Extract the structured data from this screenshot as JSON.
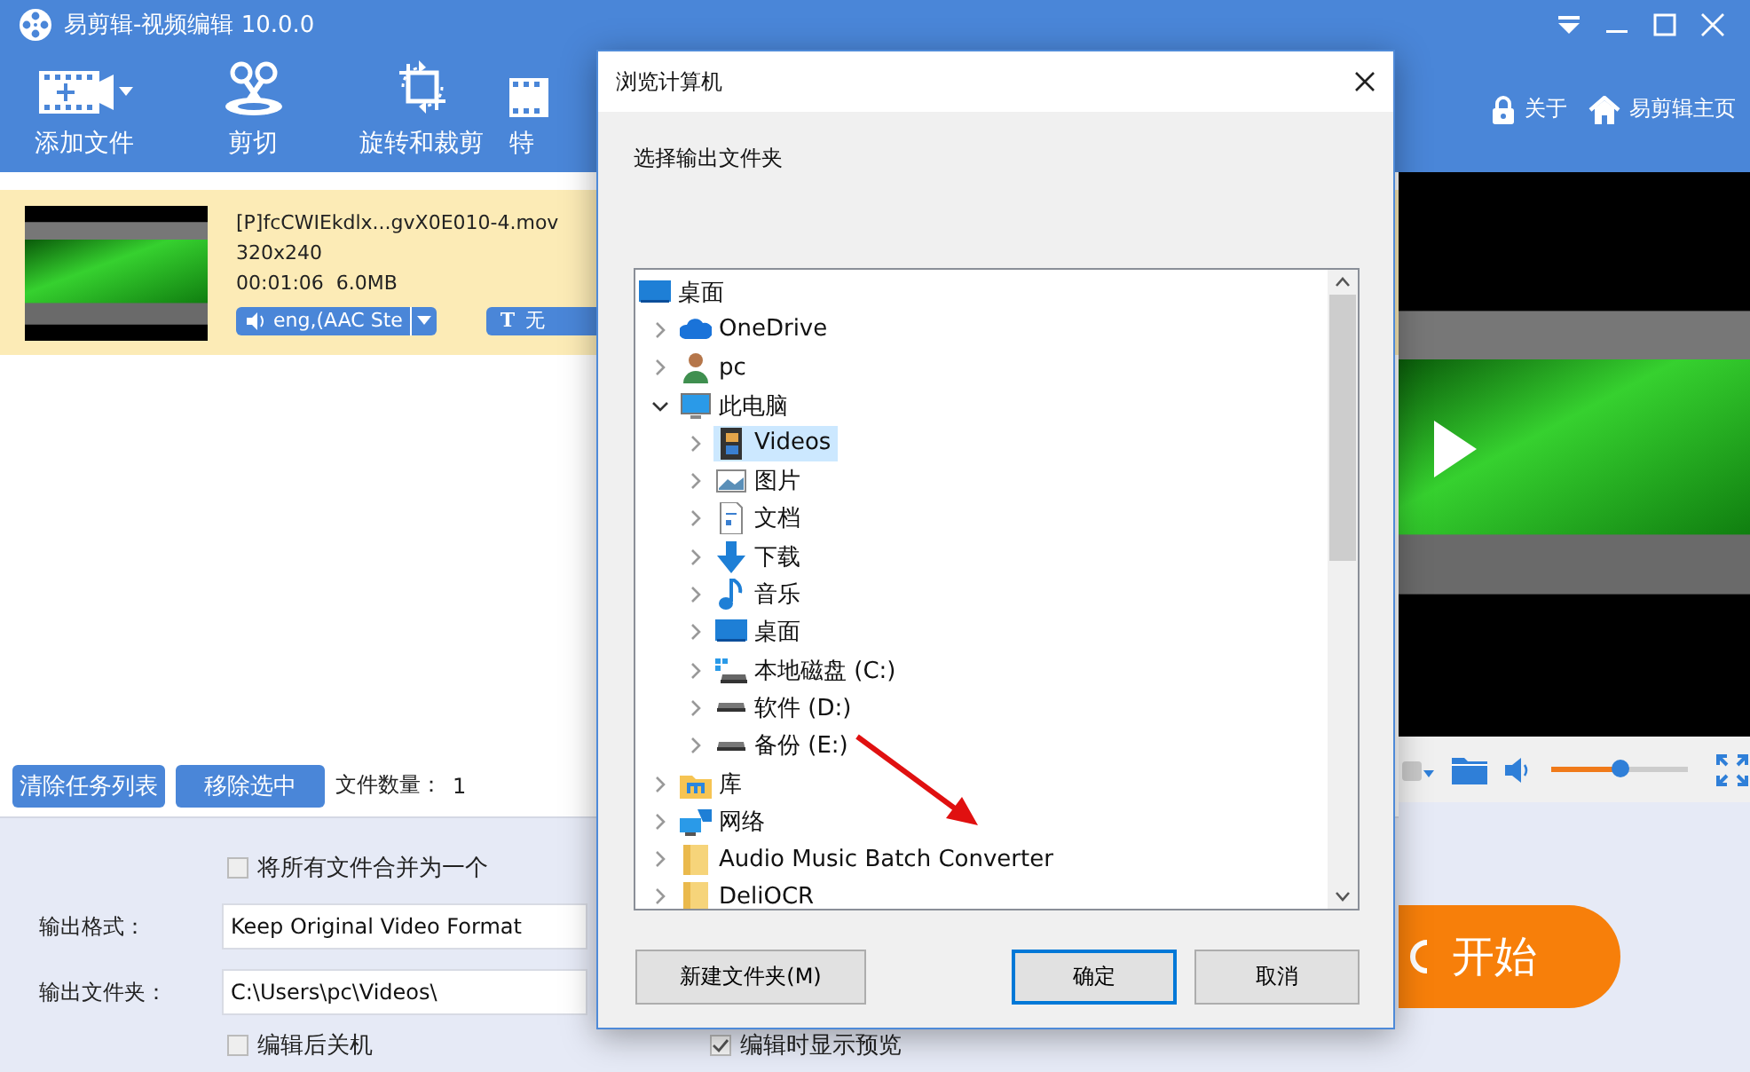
{
  "window": {
    "title": "易剪辑-视频编辑 10.0.0"
  },
  "toolbar": {
    "tools": [
      {
        "label": "添加文件",
        "kind": "add-file"
      },
      {
        "label": "剪切",
        "kind": "cut"
      },
      {
        "label": "旋转和裁剪",
        "kind": "rotate-crop"
      },
      {
        "label": "特",
        "kind": "effects"
      }
    ],
    "links": [
      {
        "label": "关于",
        "kind": "about"
      },
      {
        "label": "易剪辑主页",
        "kind": "home"
      }
    ]
  },
  "files": [
    {
      "name": "[P]fcCWIEkdlx...gvX0E010-4.mov",
      "resolution": "320x240",
      "duration": "00:01:06",
      "size": "6.0MB",
      "audio_track": "eng,(AAC Ste",
      "subtitle": {
        "icon": "T",
        "label": "无"
      },
      "selected": true
    }
  ],
  "list_actions": {
    "buttons": [
      "清除任务列表",
      "移除选中"
    ],
    "file_count_label": "文件数量：",
    "file_count": "1"
  },
  "settings": {
    "merge": {
      "label": "将所有文件合并为一个",
      "checked": false
    },
    "output_format": {
      "label": "输出格式：",
      "value": "Keep Original Video Format"
    },
    "output_folder": {
      "label": "输出文件夹：",
      "value": "C:\\Users\\pc\\Videos\\"
    },
    "shutdown": {
      "label": "编辑后关机",
      "checked": false
    },
    "preview_while_editing": {
      "label": "编辑时显示预览",
      "checked": true
    }
  },
  "preview": {
    "volume": {
      "level": 0.5
    }
  },
  "start_button": "开始",
  "dialog": {
    "title": "浏览计算机",
    "prompt": "选择输出文件夹",
    "tree": [
      {
        "label": "桌面",
        "kind": "desktop",
        "selected": false,
        "children": [
          {
            "label": "OneDrive",
            "kind": "cloud",
            "expanded": false,
            "selected": false
          },
          {
            "label": "pc",
            "kind": "user",
            "expanded": false,
            "selected": false
          },
          {
            "label": "此电脑",
            "kind": "computer",
            "expanded": true,
            "selected": false,
            "children": [
              {
                "label": "Videos",
                "kind": "videos",
                "expanded": false,
                "selected": true
              },
              {
                "label": "图片",
                "kind": "pictures",
                "expanded": false,
                "selected": false
              },
              {
                "label": "文档",
                "kind": "documents",
                "expanded": false,
                "selected": false
              },
              {
                "label": "下载",
                "kind": "downloads",
                "expanded": false,
                "selected": false
              },
              {
                "label": "音乐",
                "kind": "music",
                "expanded": false,
                "selected": false
              },
              {
                "label": "桌面",
                "kind": "desktop",
                "expanded": false,
                "selected": false
              },
              {
                "label": "本地磁盘 (C:)",
                "kind": "system-drive",
                "expanded": false,
                "selected": false
              },
              {
                "label": "软件 (D:)",
                "kind": "drive",
                "expanded": false,
                "selected": false
              },
              {
                "label": "备份 (E:)",
                "kind": "drive",
                "expanded": false,
                "selected": false
              }
            ]
          },
          {
            "label": "库",
            "kind": "library",
            "expanded": false,
            "selected": false
          },
          {
            "label": "网络",
            "kind": "network",
            "expanded": false,
            "selected": false
          },
          {
            "label": "Audio Music Batch Converter",
            "kind": "folder",
            "expanded": false,
            "selected": false
          },
          {
            "label": "DeliOCR",
            "kind": "folder",
            "expanded": false,
            "selected": false
          }
        ]
      }
    ],
    "buttons": [
      {
        "label": "新建文件夹(M)",
        "default": false
      },
      {
        "label": "确定",
        "default": true
      },
      {
        "label": "取消",
        "default": false
      }
    ]
  }
}
